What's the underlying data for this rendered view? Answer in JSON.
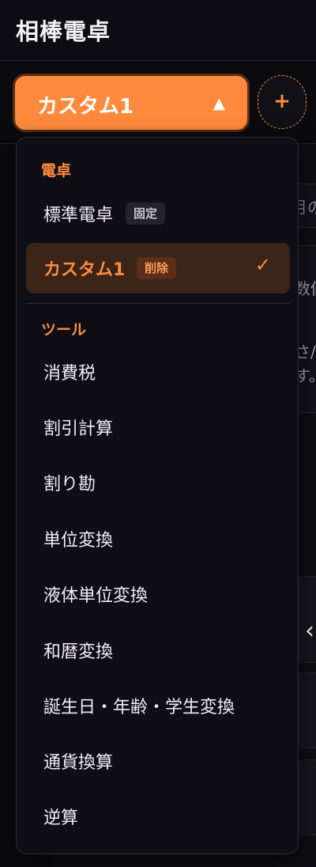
{
  "header": {
    "title": "相棒電卓"
  },
  "selector": {
    "current": "カスタム1",
    "arrow_icon": "▲",
    "add_icon": "+"
  },
  "background_fragments": {
    "input_hint": "月の",
    "line1": "数値",
    "line2": "さ/",
    "line3": "す。",
    "chevron": "‹"
  },
  "dropdown": {
    "section_calculators": "電卓",
    "standard": {
      "label": "標準電卓",
      "badge": "固定"
    },
    "custom": {
      "label": "カスタム1",
      "badge": "削除",
      "check_icon": "✓"
    },
    "section_tools": "ツール",
    "tools": [
      "消費税",
      "割引計算",
      "割り勘",
      "単位変換",
      "液体単位変換",
      "和暦変換",
      "誕生日・年齢・学生変換",
      "通貨換算",
      "逆算"
    ]
  },
  "colors": {
    "accent": "#ff8a3d",
    "background": "#0b0a0f",
    "panel": "#0f0e14"
  }
}
